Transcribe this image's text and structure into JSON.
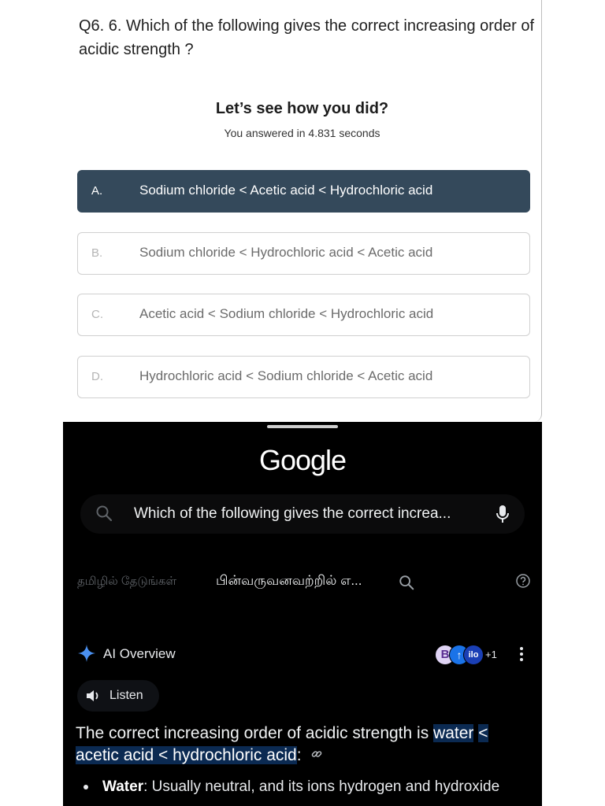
{
  "quiz": {
    "question": "Q6. 6. Which of the following gives the correct increasing order of acidic strength ?",
    "result_heading": "Let’s see how you did?",
    "result_time": "You answered in 4.831 seconds",
    "options": [
      {
        "letter": "A.",
        "text": "Sodium chloride < Acetic acid < Hydrochloric acid",
        "selected": true
      },
      {
        "letter": "B.",
        "text": "Sodium chloride < Hydrochloric acid < Acetic acid",
        "selected": false
      },
      {
        "letter": "C.",
        "text": "Acetic acid < Sodium chloride < Hydrochloric acid",
        "selected": false
      },
      {
        "letter": "D.",
        "text": "Hydrochloric acid < Sodium chloride < Acetic acid",
        "selected": false
      }
    ]
  },
  "google": {
    "logo": "Google",
    "search": {
      "query": "Which of the following gives the correct increa...",
      "icon": "search-icon",
      "mic_icon": "mic-icon"
    },
    "filters": {
      "tamil": "தமிழில் தேடுங்கள்",
      "related": "பின்வருவனவற்றில் எ..."
    },
    "ai_overview": {
      "title": "AI Overview",
      "sources": {
        "b": "B",
        "ilo": "ilo",
        "more": "+1"
      },
      "listen_label": "Listen",
      "answer_plain": "The correct increasing order of acidic strength is ",
      "answer_highlight_1": "water",
      "answer_highlight_2": "< acetic acid < hydrochloric acid",
      "answer_colon": ":",
      "bullets": [
        {
          "term": "Water",
          "text": ": Usually neutral, and its ions hydrogen and hydroxide"
        }
      ]
    },
    "colors": {
      "selected_option": "#34495b",
      "highlight": "#0b2a52",
      "panel_bg": "#000000"
    }
  }
}
